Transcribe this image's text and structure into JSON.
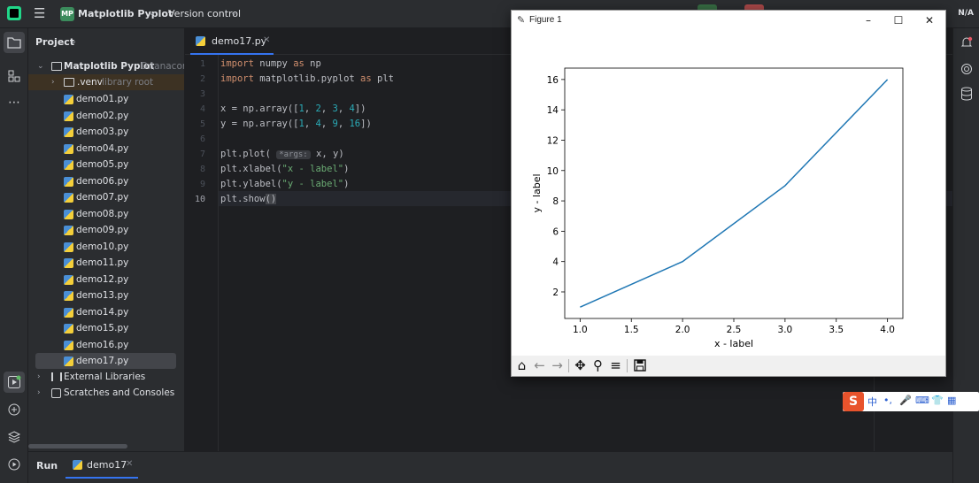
{
  "titlebar": {
    "project_badge": "MP",
    "project_name": "Matplotlib Pyplot",
    "vcs": "Version control",
    "right_text": "N/A"
  },
  "project_panel": {
    "title": "Project",
    "root": {
      "name": "Matplotlib Pyplot",
      "path": "D:\\anacond"
    },
    "venv": {
      "name": ".venv",
      "note": "library root"
    },
    "files": [
      "demo01.py",
      "demo02.py",
      "demo03.py",
      "demo04.py",
      "demo05.py",
      "demo06.py",
      "demo07.py",
      "demo08.py",
      "demo09.py",
      "demo10.py",
      "demo11.py",
      "demo12.py",
      "demo13.py",
      "demo14.py",
      "demo15.py",
      "demo16.py",
      "demo17.py"
    ],
    "selected_file": "demo17.py",
    "external_libraries": "External Libraries",
    "scratches": "Scratches and Consoles"
  },
  "editor": {
    "tab_label": "demo17.py",
    "line_numbers": [
      "1",
      "2",
      "3",
      "4",
      "5",
      "6",
      "7",
      "8",
      "9",
      "10"
    ],
    "current_line": "10",
    "code": {
      "l1_kw1": "import",
      "l1_mod": " numpy ",
      "l1_kw2": "as",
      "l1_alias": " np",
      "l2_kw1": "import",
      "l2_mod": " matplotlib.pyplot ",
      "l2_kw2": "as",
      "l2_alias": " plt",
      "l4_a": "x = np.array([",
      "l4_n1": "1",
      "l4_c1": ", ",
      "l4_n2": "2",
      "l4_c2": ", ",
      "l4_n3": "3",
      "l4_c3": ", ",
      "l4_n4": "4",
      "l4_b": "])",
      "l5_a": "y = np.array([",
      "l5_n1": "1",
      "l5_c1": ", ",
      "l5_n2": "4",
      "l5_c2": ", ",
      "l5_n3": "9",
      "l5_c3": ", ",
      "l5_n4": "16",
      "l5_b": "])",
      "l7_a": "plt.plot( ",
      "l7_hint": "*args:",
      "l7_b": " x, y)",
      "l8_a": "plt.xlabel(",
      "l8_s": "\"x - label\"",
      "l8_b": ")",
      "l9_a": "plt.ylabel(",
      "l9_s": "\"y - label\"",
      "l9_b": ")",
      "l10_a": "plt.show",
      "l10_b": "()"
    }
  },
  "runbar": {
    "label": "Run",
    "tab": "demo17"
  },
  "figure_window": {
    "title": "Figure 1",
    "controls": {
      "minimize": "–",
      "maximize": "☐",
      "close": "✕"
    },
    "toolbar_icons": [
      "home-icon",
      "back-icon",
      "forward-icon",
      "pan-icon",
      "zoom-icon",
      "configure-subplots-icon",
      "save-icon"
    ]
  },
  "ime": {
    "logo": "S",
    "mode": "中",
    "punct": "•,",
    "mic": "🎤",
    "keyboard": "⌨",
    "skin": "👕",
    "apps": "▦"
  },
  "chart_data": {
    "type": "line",
    "x": [
      1,
      2,
      3,
      4
    ],
    "series": [
      {
        "values": [
          1,
          4,
          9,
          16
        ],
        "color": "#1f77b4"
      }
    ],
    "xlabel": "x - label",
    "ylabel": "y - label",
    "xlim": [
      0.85,
      4.15
    ],
    "ylim": [
      0.25,
      16.75
    ],
    "xticks": [
      "1.0",
      "1.5",
      "2.0",
      "2.5",
      "3.0",
      "3.5",
      "4.0"
    ],
    "yticks": [
      "2",
      "4",
      "6",
      "8",
      "10",
      "12",
      "14",
      "16"
    ],
    "grid": false
  }
}
